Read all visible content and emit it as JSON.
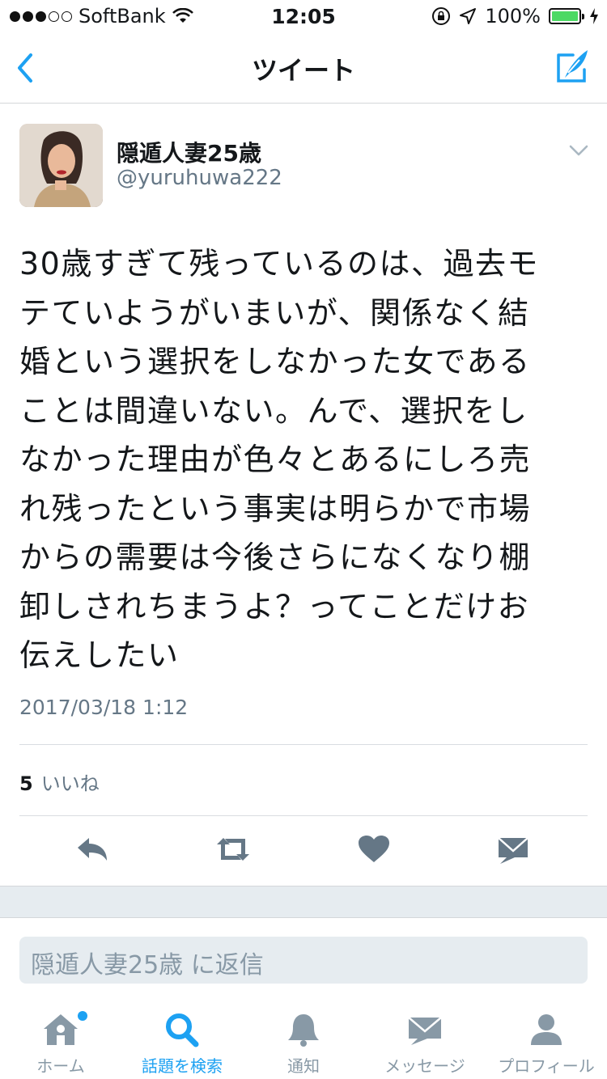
{
  "status_bar": {
    "carrier": "SoftBank",
    "time": "12:05",
    "battery": "100%"
  },
  "nav": {
    "title": "ツイート"
  },
  "tweet": {
    "name": "隠遁人妻25歳",
    "handle": "@yuruhuwa222",
    "lines": [
      "30歳すぎて残っているのは、過去モ",
      "テていようがいまいが、関係なく結",
      "婚という選択をしなかった女である",
      "ことは間違いない。んで、選択をし",
      "なかった理由が色々とあるにしろ売",
      "れ残ったという事実は明らかで市場",
      "からの需要は今後さらになくなり棚",
      "卸しされちまうよ？ってことだけお",
      "伝えしたい"
    ],
    "timestamp": "2017/03/18 1:12",
    "likes_count": "5",
    "likes_label": "いいね"
  },
  "reply": {
    "placeholder": "隠遁人妻25歳 に返信"
  },
  "tabs": [
    {
      "label": "ホーム",
      "icon": "home-icon",
      "active": false
    },
    {
      "label": "話題を検索",
      "icon": "search-icon",
      "active": true
    },
    {
      "label": "通知",
      "icon": "bell-icon",
      "active": false
    },
    {
      "label": "メッセージ",
      "icon": "envelope-icon",
      "active": false
    },
    {
      "label": "プロフィール",
      "icon": "person-icon",
      "active": false
    }
  ],
  "colors": {
    "accent": "#1da1f2",
    "secondary_text": "#657786",
    "muted": "#8899a6",
    "battery": "#4cd964"
  }
}
